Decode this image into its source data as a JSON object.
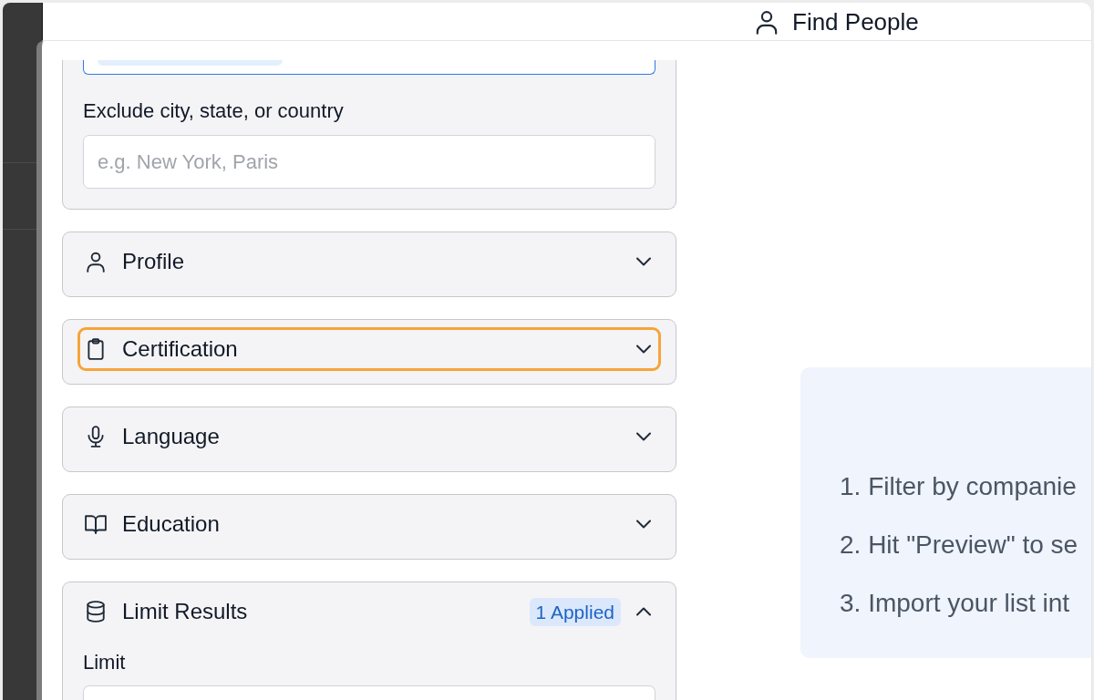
{
  "header": {
    "title": "Find People"
  },
  "filters": {
    "location": {
      "fields": [
        {
          "label": "Exclude city, state, or country",
          "placeholder": "e.g. New York, Paris"
        }
      ]
    },
    "sections": [
      {
        "kind": "profile",
        "title": "Profile",
        "expanded": false,
        "focused": false
      },
      {
        "kind": "certification",
        "title": "Certification",
        "expanded": false,
        "focused": true
      },
      {
        "kind": "language",
        "title": "Language",
        "expanded": false,
        "focused": false
      },
      {
        "kind": "education",
        "title": "Education",
        "expanded": false,
        "focused": false
      },
      {
        "kind": "limit",
        "title": "Limit Results",
        "expanded": true,
        "focused": false,
        "badge": "1 Applied",
        "fields": [
          {
            "label": "Limit"
          }
        ]
      }
    ]
  },
  "instructions": {
    "steps": [
      "1. Filter by companie",
      "2. Hit \"Preview\" to se",
      "3. Import your list int"
    ]
  }
}
